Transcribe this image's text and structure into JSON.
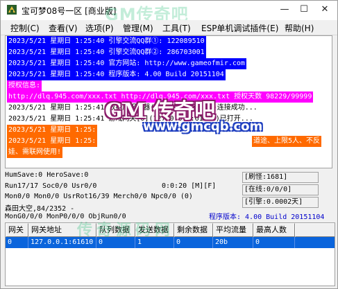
{
  "window": {
    "title": "宝可梦08号一区 [商业版]",
    "watermark_top": "GM传奇吧",
    "minimize": "—",
    "maximize": "☐",
    "close": "✕"
  },
  "menu": [
    "控制(C)",
    "查看(V)",
    "选项(P)",
    "管理(M)",
    "工具(T)",
    "ESP单机调试插件(E)",
    "帮助(H)"
  ],
  "log": [
    {
      "text": "2023/5/21 星期日 1:25:40 引擎交流QQ群①: 122089510",
      "style": "blue"
    },
    {
      "text": "2023/5/21 星期日 1:25:40 引擎交流QQ群②: 286703001",
      "style": "blue"
    },
    {
      "text": "2023/5/21 星期日 1:25:40 官方网站: http://www.gameofmir.com",
      "style": "blue"
    },
    {
      "text": "2023/5/21 星期日 1:25:40 程序版本: 4.00 Build 20151104",
      "style": "blue"
    },
    {
      "text": "授权信息:",
      "style": "magenta"
    },
    {
      "text": "http://dlq.945.com/xxx.txt http://dlq.945.com/xxx.txt 授权天数 98229/99999",
      "style": "magenta"
    },
    {
      "text": "2023/5/21 星期日 1:25:41 数据库服务器(127.0.0.1:6000)连接成功...",
      "style": "plain"
    },
    {
      "text": "2023/5/21 星期日 1:25:41 游戏网关[0](127.0.0.1:61610)已打开...",
      "style": "plain"
    },
    {
      "text": "2023/5/21 星期日 1:25:",
      "style": "orange"
    },
    {
      "text": "2023/5/21 星期日 1:25:",
      "style": "orange"
    },
    {
      "text": "娃、需联网使用!",
      "style": "orange"
    },
    {
      "text": "道途、上限5人、不反",
      "style": "orange"
    }
  ],
  "watermark": {
    "logo": "GM 传奇吧",
    "url": "www.gmcqb.com",
    "bottom": "传奇源码网"
  },
  "status": {
    "line1": "HumSave:0 HeroSave:0",
    "line2": "Run17/17 Soc0/0 Usr0/0",
    "timer": "0:0:20 [M][F]",
    "line3": "Mon0/0 Mon0/0 UsrRot16/39 Merch0/0 Npc0/0 (0)",
    "line4": "森田大空,84/2352 -",
    "line5": "MonG0/0/0 MonP0/0/0 ObjRun0/0",
    "refresh": "[刷怪:1681]",
    "online": "[在线:0/0/0]",
    "memory": "[引擎:0.0002天]",
    "version": "程序版本: 4.00 Build 20151104"
  },
  "table": {
    "headers": [
      "网关",
      "网关地址",
      "队列数据",
      "发送数据",
      "剩余数据",
      "平均流量",
      "最高人数"
    ],
    "rows": [
      [
        "0",
        "127.0.0.1:61610",
        "0",
        "1",
        "0",
        "20b",
        "0"
      ]
    ]
  }
}
